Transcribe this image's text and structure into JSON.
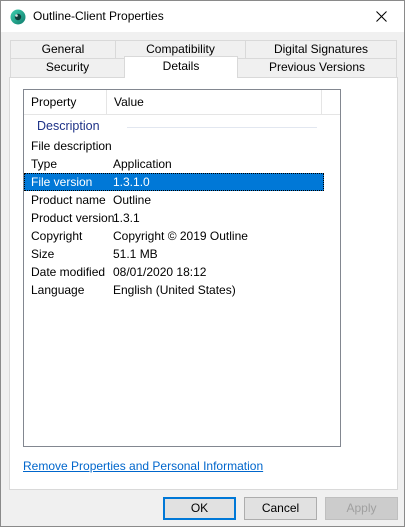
{
  "window": {
    "title": "Outline-Client Properties",
    "icon": "outline-app-icon"
  },
  "tabs": {
    "row1": [
      {
        "label": "General"
      },
      {
        "label": "Compatibility"
      },
      {
        "label": "Digital Signatures"
      }
    ],
    "row2": [
      {
        "label": "Security"
      },
      {
        "label": "Details",
        "active": true
      },
      {
        "label": "Previous Versions"
      }
    ]
  },
  "details": {
    "header": {
      "property": "Property",
      "value": "Value"
    },
    "group_label": "Description",
    "rows": [
      {
        "property": "File description",
        "value": ""
      },
      {
        "property": "Type",
        "value": "Application"
      },
      {
        "property": "File version",
        "value": "1.3.1.0",
        "selected": true
      },
      {
        "property": "Product name",
        "value": "Outline"
      },
      {
        "property": "Product version",
        "value": "1.3.1"
      },
      {
        "property": "Copyright",
        "value": "Copyright © 2019 Outline"
      },
      {
        "property": "Size",
        "value": "51.1 MB"
      },
      {
        "property": "Date modified",
        "value": "08/01/2020 18:12"
      },
      {
        "property": "Language",
        "value": "English (United States)"
      }
    ]
  },
  "remove_link": "Remove Properties and Personal Information",
  "buttons": {
    "ok": "OK",
    "cancel": "Cancel",
    "apply": "Apply"
  },
  "colors": {
    "selection": "#0078d7",
    "group_label": "#1e3287",
    "link": "#0066cc"
  }
}
